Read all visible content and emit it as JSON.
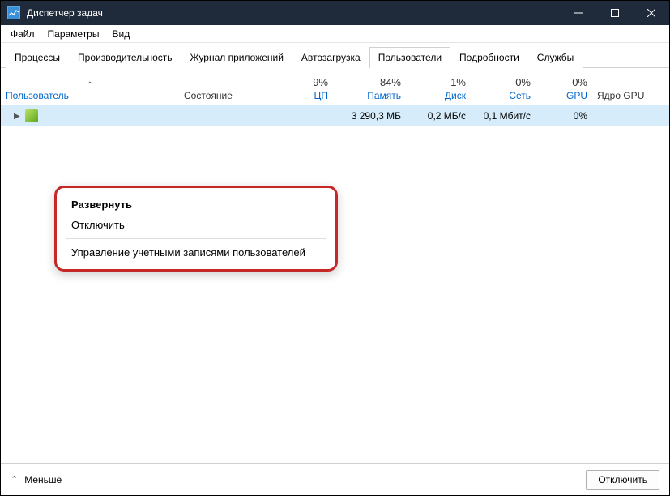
{
  "window": {
    "title": "Диспетчер задач"
  },
  "menu": {
    "file": "Файл",
    "options": "Параметры",
    "view": "Вид"
  },
  "tabs": {
    "processes": "Процессы",
    "performance": "Производительность",
    "app_history": "Журнал приложений",
    "startup": "Автозагрузка",
    "users": "Пользователи",
    "details": "Подробности",
    "services": "Службы"
  },
  "columns": {
    "user": "Пользователь",
    "status": "Состояние",
    "cpu_pct": "9%",
    "cpu_label": "ЦП",
    "mem_pct": "84%",
    "mem_label": "Память",
    "disk_pct": "1%",
    "disk_label": "Диск",
    "net_pct": "0%",
    "net_label": "Сеть",
    "gpu_pct": "0%",
    "gpu_label": "GPU",
    "gpu_engine": "Ядро GPU"
  },
  "row": {
    "memory": "3 290,3 МБ",
    "disk": "0,2 МБ/с",
    "network": "0,1 Мбит/с",
    "gpu": "0%"
  },
  "context_menu": {
    "expand": "Развернуть",
    "disconnect": "Отключить",
    "manage_accounts": "Управление учетными записями пользователей"
  },
  "footer": {
    "less": "Меньше",
    "disconnect": "Отключить"
  }
}
